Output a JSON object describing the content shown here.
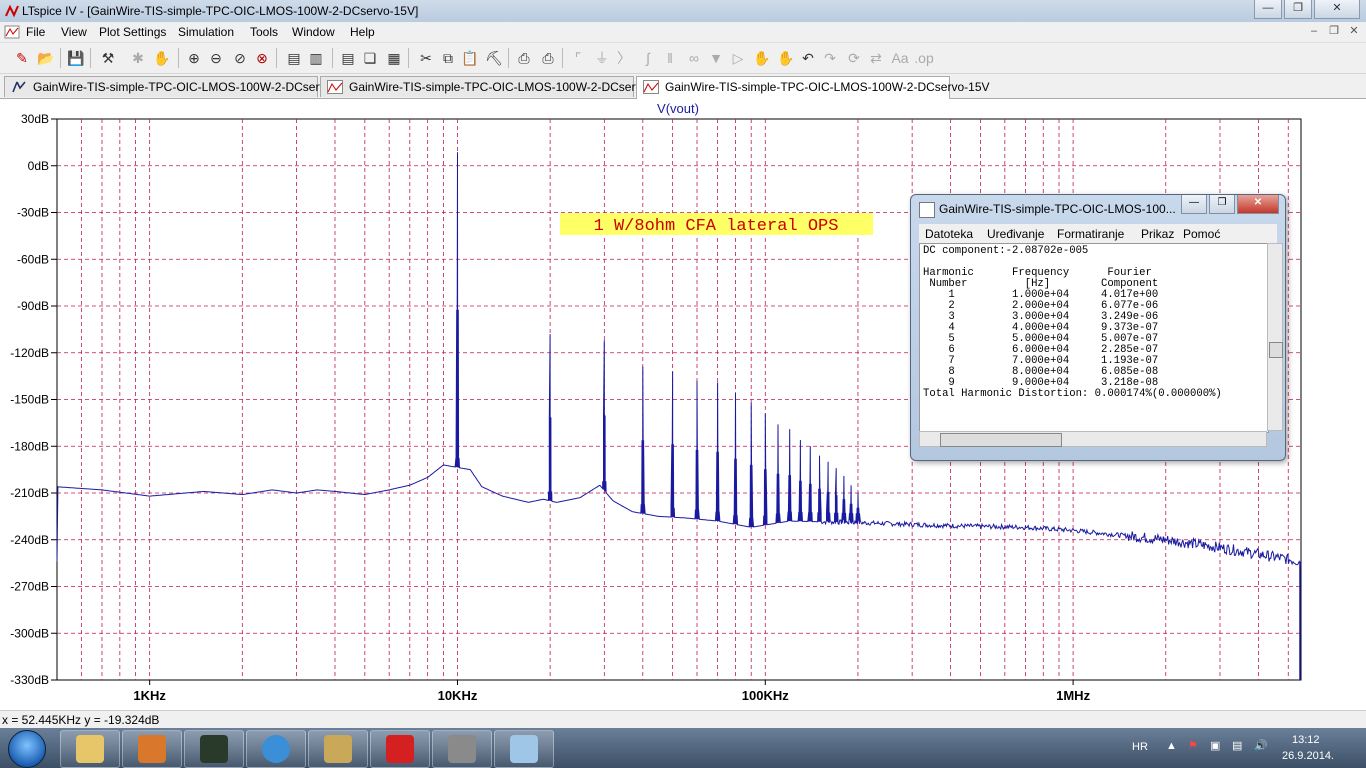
{
  "window": {
    "title": "LTspice IV - [GainWire-TIS-simple-TPC-OIC-LMOS-100W-2-DCservo-15V]"
  },
  "menu": [
    "File",
    "View",
    "Plot Settings",
    "Simulation",
    "Tools",
    "Window",
    "Help"
  ],
  "tabs": [
    {
      "label": "GainWire-TIS-simple-TPC-OIC-LMOS-100W-2-DCservo-15V",
      "kind": "schematic"
    },
    {
      "label": "GainWire-TIS-simple-TPC-OIC-LMOS-100W-2-DCservo-15V",
      "kind": "waveform"
    },
    {
      "label": "GainWire-TIS-simple-TPC-OIC-LMOS-100W-2-DCservo-15V",
      "kind": "waveform",
      "active": true
    }
  ],
  "chart_data": {
    "type": "line",
    "title": "V(vout)",
    "annotation": "1 W/8ohm CFA lateral OPS",
    "x_scale": "log",
    "xlim": [
      500,
      5500000
    ],
    "ylim": [
      -330,
      30
    ],
    "x_tick_labels": [
      "1KHz",
      "10KHz",
      "100KHz",
      "1MHz"
    ],
    "x_ticks": [
      1000,
      10000,
      100000,
      1000000
    ],
    "y_ticks": [
      30,
      0,
      -30,
      -60,
      -90,
      -120,
      -150,
      -180,
      -210,
      -240,
      -270,
      -300,
      -330
    ],
    "y_tick_labels": [
      "30dB",
      "0dB",
      "-30dB",
      "-60dB",
      "-90dB",
      "-120dB",
      "-150dB",
      "-180dB",
      "-210dB",
      "-240dB",
      "-270dB",
      "-300dB",
      "-330dB"
    ],
    "grid": true,
    "series": [
      {
        "color": "#1a1aa0",
        "noise_floor": [
          [
            500,
            -206
          ],
          [
            700,
            -208
          ],
          [
            1000,
            -212
          ],
          [
            1500,
            -209
          ],
          [
            2000,
            -211
          ],
          [
            2500,
            -208
          ],
          [
            3000,
            -210
          ],
          [
            3500,
            -208
          ],
          [
            4000,
            -209
          ],
          [
            5000,
            -211
          ],
          [
            6000,
            -208
          ],
          [
            7000,
            -205
          ],
          [
            8000,
            -200
          ],
          [
            9000,
            -192
          ],
          [
            11000,
            -195
          ],
          [
            12000,
            -206
          ],
          [
            14000,
            -212
          ],
          [
            17000,
            -216
          ],
          [
            19000,
            -214
          ],
          [
            21000,
            -216
          ],
          [
            25000,
            -213
          ],
          [
            29000,
            -205
          ],
          [
            32000,
            -215
          ],
          [
            37000,
            -222
          ],
          [
            45000,
            -225
          ],
          [
            55000,
            -226
          ],
          [
            70000,
            -228
          ],
          [
            90000,
            -232
          ],
          [
            120000,
            -228
          ],
          [
            200000,
            -229
          ],
          [
            400000,
            -231
          ],
          [
            700000,
            -232
          ],
          [
            1000000,
            -234
          ],
          [
            2000000,
            -240
          ],
          [
            3000000,
            -245
          ],
          [
            5500000,
            -254
          ]
        ],
        "peaks": [
          [
            10000,
            8.7
          ],
          [
            20000,
            -108
          ],
          [
            30000,
            -112
          ],
          [
            40000,
            -129
          ],
          [
            50000,
            -132
          ],
          [
            60000,
            -138
          ],
          [
            70000,
            -139
          ],
          [
            80000,
            -146
          ],
          [
            90000,
            -152
          ],
          [
            100000,
            -159
          ],
          [
            110000,
            -166
          ],
          [
            120000,
            -169
          ],
          [
            130000,
            -176
          ],
          [
            140000,
            -180
          ],
          [
            150000,
            -186
          ],
          [
            160000,
            -190
          ],
          [
            170000,
            -194
          ],
          [
            180000,
            -199
          ],
          [
            190000,
            -205
          ],
          [
            200000,
            -210
          ]
        ]
      }
    ]
  },
  "fft_window": {
    "title": "GainWire-TIS-simple-TPC-OIC-LMOS-100...",
    "menu": [
      "Datoteka",
      "Uređivanje",
      "Formatiranje",
      "Prikaz",
      "Pomoć"
    ],
    "lines": [
      "DC component:-2.08702e-005",
      "",
      "Harmonic      Frequency      Fourier",
      " Number         [Hz]        Component",
      "    1         1.000e+04     4.017e+00",
      "    2         2.000e+04     6.077e-06",
      "    3         3.000e+04     3.249e-06",
      "    4         4.000e+04     9.373e-07",
      "    5         5.000e+04     5.007e-07",
      "    6         6.000e+04     2.285e-07",
      "    7         7.000e+04     1.193e-07",
      "    8         8.000e+04     6.085e-08",
      "    9         9.000e+04     3.218e-08",
      "Total Harmonic Distortion: 0.000174%(0.000000%)"
    ]
  },
  "status": {
    "cursor": "x = 52.445KHz   y = -19.324dB"
  },
  "tray": {
    "lang": "HR",
    "time": "13:12",
    "date": "26.9.2014."
  }
}
